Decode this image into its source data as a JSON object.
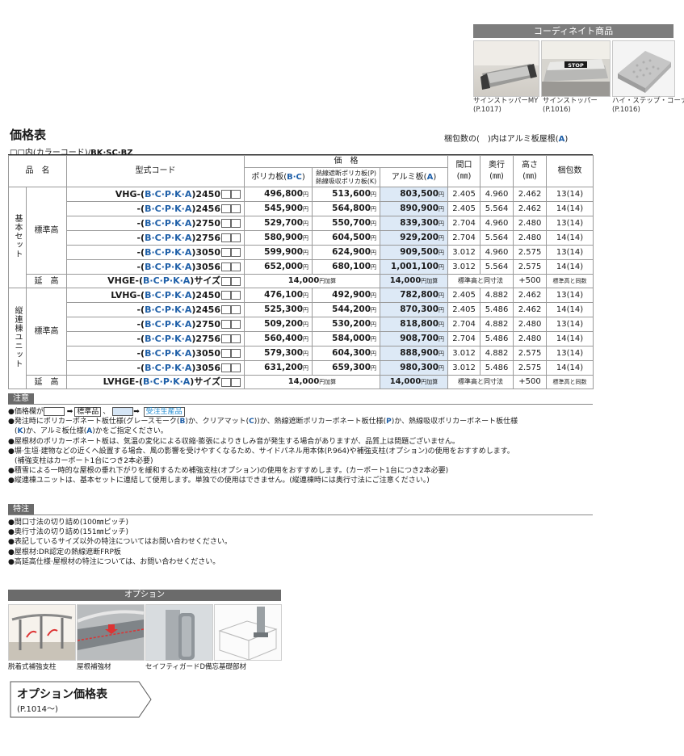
{
  "coordinate": {
    "header": "コーディネイト商品",
    "items": [
      {
        "name": "サインストッパーMY",
        "page": "(P.1017)"
      },
      {
        "name": "サインストッパー",
        "page": "(P.1016)",
        "sign": "STOP"
      },
      {
        "name": "ハイ・ステップ・コーナー",
        "page": "(P.1016)"
      }
    ]
  },
  "title": "価格表",
  "pack_note": {
    "pre": "梱包数の(　)内はアルミ板屋根(",
    "letter": "A",
    "post": ")"
  },
  "color_note": {
    "pre": "□□内(カラーコード)/",
    "codes": "BK·SC·BZ"
  },
  "table": {
    "headers": {
      "name": "品　名",
      "code": "型式コード",
      "price_group": "価　格",
      "polica": "ポリカ板(B·C)",
      "polica_pre": "ポリカ板(",
      "polica_letters": "B·C",
      "polica_post": ")",
      "heat1": "熱線遮断ポリカ板(P)",
      "heat2": "熱線吸収ポリカ板(K)",
      "alu": "アルミ板(A)",
      "alu_pre": "アルミ板(",
      "alu_letter": "A",
      "alu_post": ")",
      "width": "間口",
      "width_unit": "(㎜)",
      "depth": "奥行",
      "depth_unit": "(㎜)",
      "height": "高さ",
      "height_unit": "(㎜)",
      "pack": "梱包数"
    },
    "yen": "円",
    "basic_set": {
      "label": "基本セット",
      "group": "標準高",
      "rows": [
        {
          "prefix": "VHG-(",
          "colors": "B·C·P·K·A",
          "suffix": ")2450",
          "p1": "496,800",
          "p2": "513,600",
          "p3": "803,500",
          "w": "2.405",
          "d": "4.960",
          "h": "2.462",
          "pack": "13(14)"
        },
        {
          "prefix": "-(",
          "colors": "B·C·P·K·A",
          "suffix": ")2456",
          "p1": "545,900",
          "p2": "564,800",
          "p3": "890,900",
          "w": "2.405",
          "d": "5.564",
          "h": "2.462",
          "pack": "14(14)"
        },
        {
          "prefix": "-(",
          "colors": "B·C·P·K·A",
          "suffix": ")2750",
          "p1": "529,700",
          "p2": "550,700",
          "p3": "839,300",
          "w": "2.704",
          "d": "4.960",
          "h": "2.480",
          "pack": "13(14)"
        },
        {
          "prefix": "-(",
          "colors": "B·C·P·K·A",
          "suffix": ")2756",
          "p1": "580,900",
          "p2": "604,500",
          "p3": "929,200",
          "w": "2.704",
          "d": "5.564",
          "h": "2.480",
          "pack": "14(14)"
        },
        {
          "prefix": "-(",
          "colors": "B·C·P·K·A",
          "suffix": ")3050",
          "p1": "599,900",
          "p2": "624,900",
          "p3": "909,500",
          "w": "3.012",
          "d": "4.960",
          "h": "2.575",
          "pack": "13(14)"
        },
        {
          "prefix": "-(",
          "colors": "B·C·P·K·A",
          "suffix": ")3056",
          "p1": "652,000",
          "p2": "680,100",
          "p3": "1,001,100",
          "w": "3.012",
          "d": "5.564",
          "h": "2.575",
          "pack": "14(14)"
        }
      ],
      "ext": {
        "label": "延　高",
        "prefix": "VHGE-(",
        "colors": "B·C·P·K·A",
        "suffix": ")サイズ",
        "price_a": "14,000",
        "price_b": "14,000",
        "add": "円加算",
        "same": "標準高と同寸法",
        "h": "+500",
        "pack": "標準高と同数"
      }
    },
    "vertical_unit": {
      "label": "縦連棟ユニット",
      "group": "標準高",
      "rows": [
        {
          "prefix": "LVHG-(",
          "colors": "B·C·P·K·A",
          "suffix": ")2450",
          "p1": "476,100",
          "p2": "492,900",
          "p3": "782,800",
          "w": "2.405",
          "d": "4.882",
          "h": "2.462",
          "pack": "13(14)"
        },
        {
          "prefix": "-(",
          "colors": "B·C·P·K·A",
          "suffix": ")2456",
          "p1": "525,300",
          "p2": "544,200",
          "p3": "870,300",
          "w": "2.405",
          "d": "5.486",
          "h": "2.462",
          "pack": "14(14)"
        },
        {
          "prefix": "-(",
          "colors": "B·C·P·K·A",
          "suffix": ")2750",
          "p1": "509,200",
          "p2": "530,200",
          "p3": "818,800",
          "w": "2.704",
          "d": "4.882",
          "h": "2.480",
          "pack": "13(14)"
        },
        {
          "prefix": "-(",
          "colors": "B·C·P·K·A",
          "suffix": ")2756",
          "p1": "560,400",
          "p2": "584,000",
          "p3": "908,700",
          "w": "2.704",
          "d": "5.486",
          "h": "2.480",
          "pack": "14(14)"
        },
        {
          "prefix": "-(",
          "colors": "B·C·P·K·A",
          "suffix": ")3050",
          "p1": "579,300",
          "p2": "604,300",
          "p3": "888,900",
          "w": "3.012",
          "d": "4.882",
          "h": "2.575",
          "pack": "13(14)"
        },
        {
          "prefix": "-(",
          "colors": "B·C·P·K·A",
          "suffix": ")3056",
          "p1": "631,200",
          "p2": "659,300",
          "p3": "980,300",
          "w": "3.012",
          "d": "5.486",
          "h": "2.575",
          "pack": "14(14)"
        }
      ],
      "ext": {
        "label": "延　高",
        "prefix": "LVHGE-(",
        "colors": "B·C·P·K·A",
        "suffix": ")サイズ",
        "price_a": "14,000",
        "price_b": "14,000",
        "add": "円加算",
        "same": "標準高と同寸法",
        "h": "+500",
        "pack": "標準高と同数"
      }
    }
  },
  "caution": {
    "badge": "注意",
    "legend_pre": "●価格欄が",
    "arrow": "➡",
    "std": "標準品",
    "sep": "、",
    "order": "受注生産品",
    "lines": [
      {
        "pre": "●発注時にポリカーボネート板仕様(グレースモーク(",
        "a": "B",
        "mid1": ")か、クリアマット(",
        "b": "C",
        "mid2": "))か、熱線遮断ポリカーボネート板仕様(",
        "c": "P",
        "mid3": ")か、熱線吸収ポリカーボネート板仕様"
      },
      {
        "pre": "(",
        "a": "K",
        "mid1": ")か、アルミ板仕様(",
        "b": "A",
        "mid2": ")かをご指定ください。"
      }
    ],
    "notes": [
      "●屋根材のポリカーボネート板は、気温の変化による収縮·膨張によりきしみ音が発生する場合がありますが、品質上は問題ございません。",
      "●塀·生垣·建物などの近くへ設置する場合、風の影響を受けやすくなるため、サイドパネル用本体(P.964)や補強支柱(オプション)の使用をおすすめします。",
      "(補強支柱はカーポート1台につき2本必要)",
      "●積雪による一時的な屋根の垂れ下がりを緩和するため補強支柱(オプション)の使用をおすすめします。(カーポート1台につき2本必要)",
      "●縦連棟ユニットは、基本セットに連結して使用します。単独での使用はできません。(縦連棟時には奥行寸法にご注意ください。)"
    ]
  },
  "special": {
    "badge": "特注",
    "notes": [
      "●間口寸法の切り詰め(100㎜ピッチ)",
      "●奥行寸法の切り詰め(151㎜ピッチ)",
      "●表記しているサイズ以外の特注についてはお問い合わせください。",
      "●屋根材:DR認定の熱線遮断FRP板",
      "●高延高仕様·屋根材の特注については、お問い合わせください。"
    ]
  },
  "option": {
    "header": "オプション",
    "items": [
      "脱着式補強支柱",
      "屋根補強材",
      "セイフティガードD",
      "備忘基礎部材"
    ]
  },
  "option_price": {
    "title": "オプション価格表",
    "page": "(P.1014〜)"
  },
  "colors": {
    "accent_blue": "#1e5fa8",
    "aluminum_column": "#dde9f6",
    "badge_gray": "#6b6b6b"
  }
}
